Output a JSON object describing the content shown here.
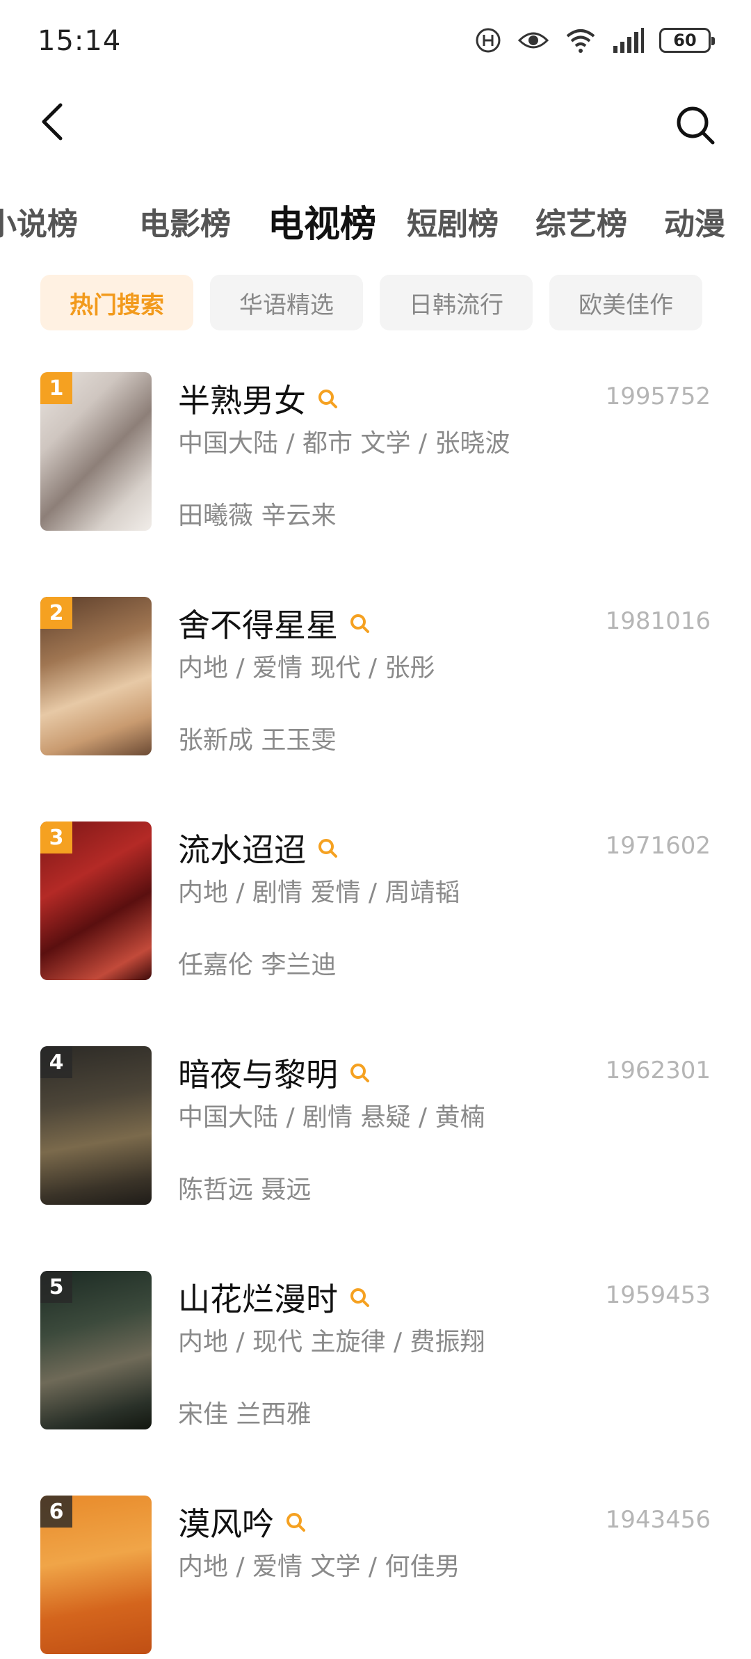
{
  "status_bar": {
    "time": "15:14",
    "battery": "60"
  },
  "tabs": [
    {
      "label": "小说榜",
      "active": false
    },
    {
      "label": "电影榜",
      "active": false
    },
    {
      "label": "电视榜",
      "active": true
    },
    {
      "label": "短剧榜",
      "active": false
    },
    {
      "label": "综艺榜",
      "active": false
    },
    {
      "label": "动漫",
      "active": false
    }
  ],
  "chips": [
    "热门搜索",
    "华语精选",
    "日韩流行",
    "欧美佳作"
  ],
  "list": [
    {
      "rank": "1",
      "title": "半熟男女",
      "meta": "中国大陆 / 都市 文学 / 张晓波",
      "cast": "田曦薇 辛云来",
      "count": "1995752"
    },
    {
      "rank": "2",
      "title": "舍不得星星",
      "meta": "内地 / 爱情 现代 / 张彤",
      "cast": "张新成 王玉雯",
      "count": "1981016"
    },
    {
      "rank": "3",
      "title": "流水迢迢",
      "meta": "内地 / 剧情 爱情 / 周靖韬",
      "cast": "任嘉伦 李兰迪",
      "count": "1971602"
    },
    {
      "rank": "4",
      "title": "暗夜与黎明",
      "meta": "中国大陆 / 剧情 悬疑 / 黄楠",
      "cast": "陈哲远 聂远",
      "count": "1962301"
    },
    {
      "rank": "5",
      "title": "山花烂漫时",
      "meta": "内地 / 现代 主旋律 / 费振翔",
      "cast": "宋佳 兰西雅",
      "count": "1959453"
    },
    {
      "rank": "6",
      "title": "漠风吟",
      "meta": "内地 / 爱情 文学 / 何佳男",
      "cast": "",
      "count": "1943456"
    }
  ],
  "colors": {
    "accent": "#f5a121",
    "chip_active_bg": "#fff1e2",
    "chip_active_text": "#f29a1c"
  }
}
